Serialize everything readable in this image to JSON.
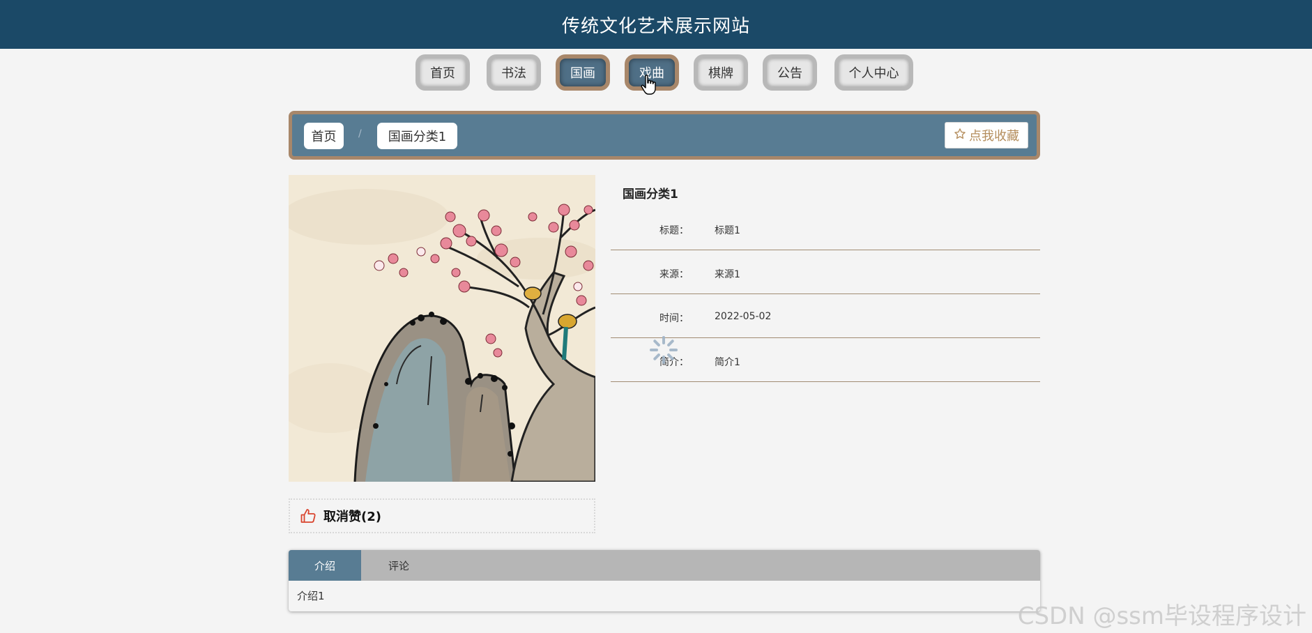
{
  "header": {
    "title": "传统文化艺术展示网站"
  },
  "nav": {
    "items": [
      {
        "label": "首页"
      },
      {
        "label": "书法"
      },
      {
        "label": "国画"
      },
      {
        "label": "戏曲"
      },
      {
        "label": "棋牌"
      },
      {
        "label": "公告"
      },
      {
        "label": "个人中心"
      }
    ],
    "active": "国画",
    "hovered": "戏曲"
  },
  "breadcrumb": {
    "home": "首页",
    "separator": "/",
    "current": "国画分类1",
    "favorite_label": "点我收藏",
    "favorite_icon": "star-outline-icon"
  },
  "detail": {
    "category": "国画分类1",
    "fields": [
      {
        "key": "标题：",
        "value": "标题1"
      },
      {
        "key": "来源：",
        "value": "来源1"
      },
      {
        "key": "时间：",
        "value": "2022-05-02"
      },
      {
        "key": "简介：",
        "value": "简介1"
      }
    ]
  },
  "like": {
    "icon": "thumbs-up-icon",
    "label": "取消赞(2)"
  },
  "tabs": {
    "items": [
      {
        "label": "介绍"
      },
      {
        "label": "评论"
      }
    ],
    "active": "介绍",
    "content": "介绍1"
  },
  "watermark": "CSDN @ssm毕设程序设计",
  "colors": {
    "header_bg": "#1b4967",
    "accent_blue": "#587c93",
    "accent_tan": "#a8876a",
    "favorite_text": "#b48d5c",
    "like_icon": "#d9442e"
  }
}
